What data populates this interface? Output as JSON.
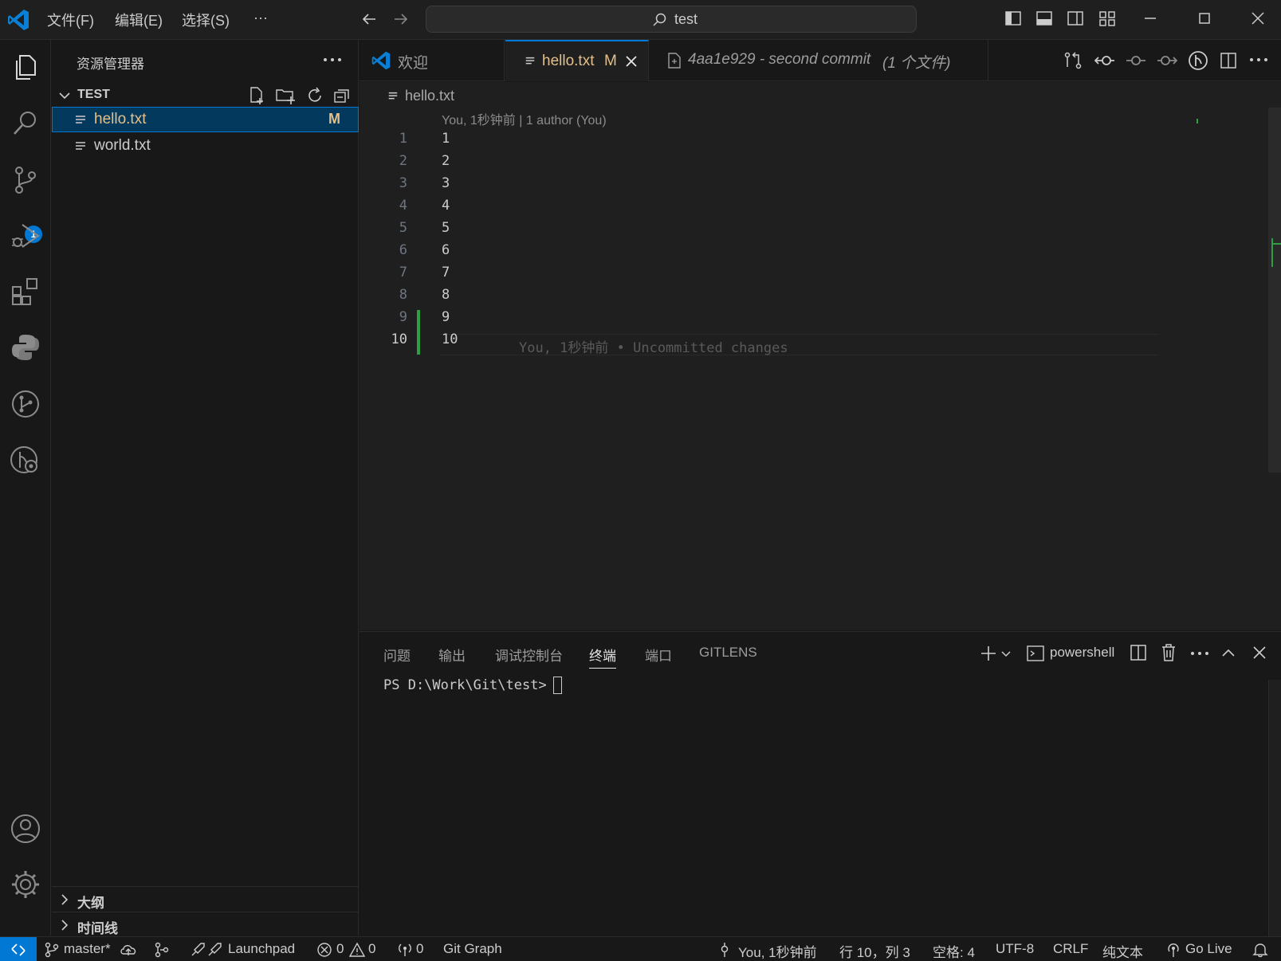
{
  "titlebar": {
    "menus": [
      "文件(F)",
      "编辑(E)",
      "选择(S)",
      "···"
    ],
    "search_text": "test"
  },
  "activitybar": {
    "scm_badge": "1"
  },
  "sidebar": {
    "title": "资源管理器",
    "folder": "TEST",
    "files": [
      {
        "name": "hello.txt",
        "badge": "M"
      },
      {
        "name": "world.txt",
        "badge": ""
      }
    ],
    "sections": [
      "大纲",
      "时间线"
    ]
  },
  "tabs": {
    "welcome": "欢迎",
    "hello": "hello.txt",
    "hello_badge": "M",
    "commit": "4aa1e929 - second commit",
    "commit_count": "(1 个文件)"
  },
  "editor": {
    "breadcrumb": "hello.txt",
    "blame_header": "You, 1秒钟前 | 1 author (You)",
    "lines": [
      "1",
      "2",
      "3",
      "4",
      "5",
      "6",
      "7",
      "8",
      "9",
      "10"
    ],
    "inline_blame": "You, 1秒钟前 • Uncommitted changes"
  },
  "panel": {
    "tabs": [
      "问题",
      "输出",
      "调试控制台",
      "终端",
      "端口",
      "GITLENS"
    ],
    "active_tab": "终端",
    "shell": "powershell",
    "prompt": "PS D:\\Work\\Git\\test>"
  },
  "statusbar": {
    "branch": "master*",
    "launchpad": "Launchpad",
    "errors": "0",
    "warnings": "0",
    "ports": "0",
    "git_graph": "Git Graph",
    "blame": "You, 1秒钟前",
    "position": "行 10，列 3",
    "spaces": "空格: 4",
    "encoding": "UTF-8",
    "eol": "CRLF",
    "language": "纯文本",
    "golive": "Go Live"
  },
  "colors": {
    "accent": "#0078d4",
    "modified": "#e2c08d",
    "added": "#2ea043"
  }
}
